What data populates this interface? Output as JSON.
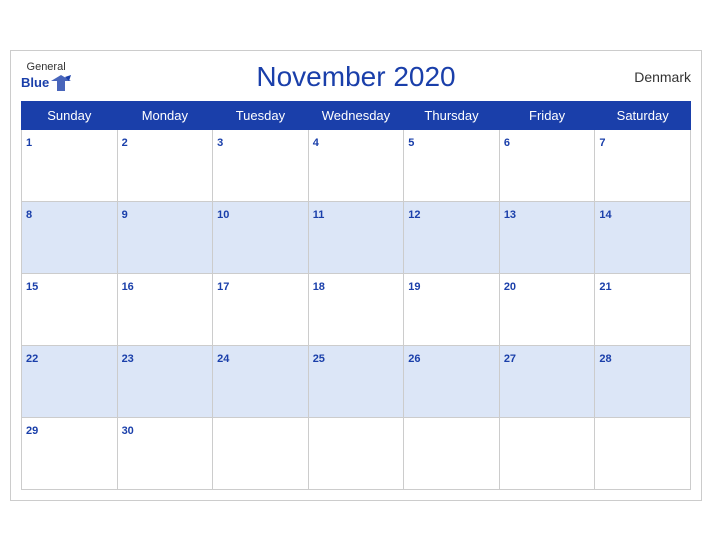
{
  "header": {
    "logo_general": "General",
    "logo_blue": "Blue",
    "title": "November 2020",
    "country": "Denmark"
  },
  "days_of_week": [
    "Sunday",
    "Monday",
    "Tuesday",
    "Wednesday",
    "Thursday",
    "Friday",
    "Saturday"
  ],
  "weeks": [
    [
      1,
      2,
      3,
      4,
      5,
      6,
      7
    ],
    [
      8,
      9,
      10,
      11,
      12,
      13,
      14
    ],
    [
      15,
      16,
      17,
      18,
      19,
      20,
      21
    ],
    [
      22,
      23,
      24,
      25,
      26,
      27,
      28
    ],
    [
      29,
      30,
      null,
      null,
      null,
      null,
      null
    ]
  ]
}
